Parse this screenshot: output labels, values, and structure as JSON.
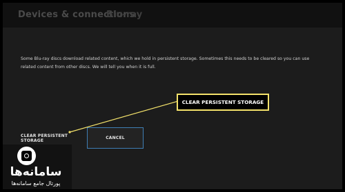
{
  "header": {
    "title": "Devices & connections",
    "subtitle": "Blu-ray"
  },
  "description": "Some Blu-ray discs download related content, which we hold in persistent storage.  Sometimes this needs to be cleared so you can use related content from other discs. We will tell you when it is full.",
  "buttons": {
    "clear_label": "CLEAR PERSISTENT STORAGE",
    "cancel_label": "CANCEL"
  },
  "callout": {
    "label": "CLEAR PERSISTENT STORAGE"
  },
  "watermark": {
    "name": "سامانه‌ها",
    "tagline": "پورتال جامع سامانه‌ها"
  },
  "colors": {
    "callout_border": "#f5e36b",
    "focus_border": "#3f7fb6",
    "background": "#1c1c1c"
  }
}
